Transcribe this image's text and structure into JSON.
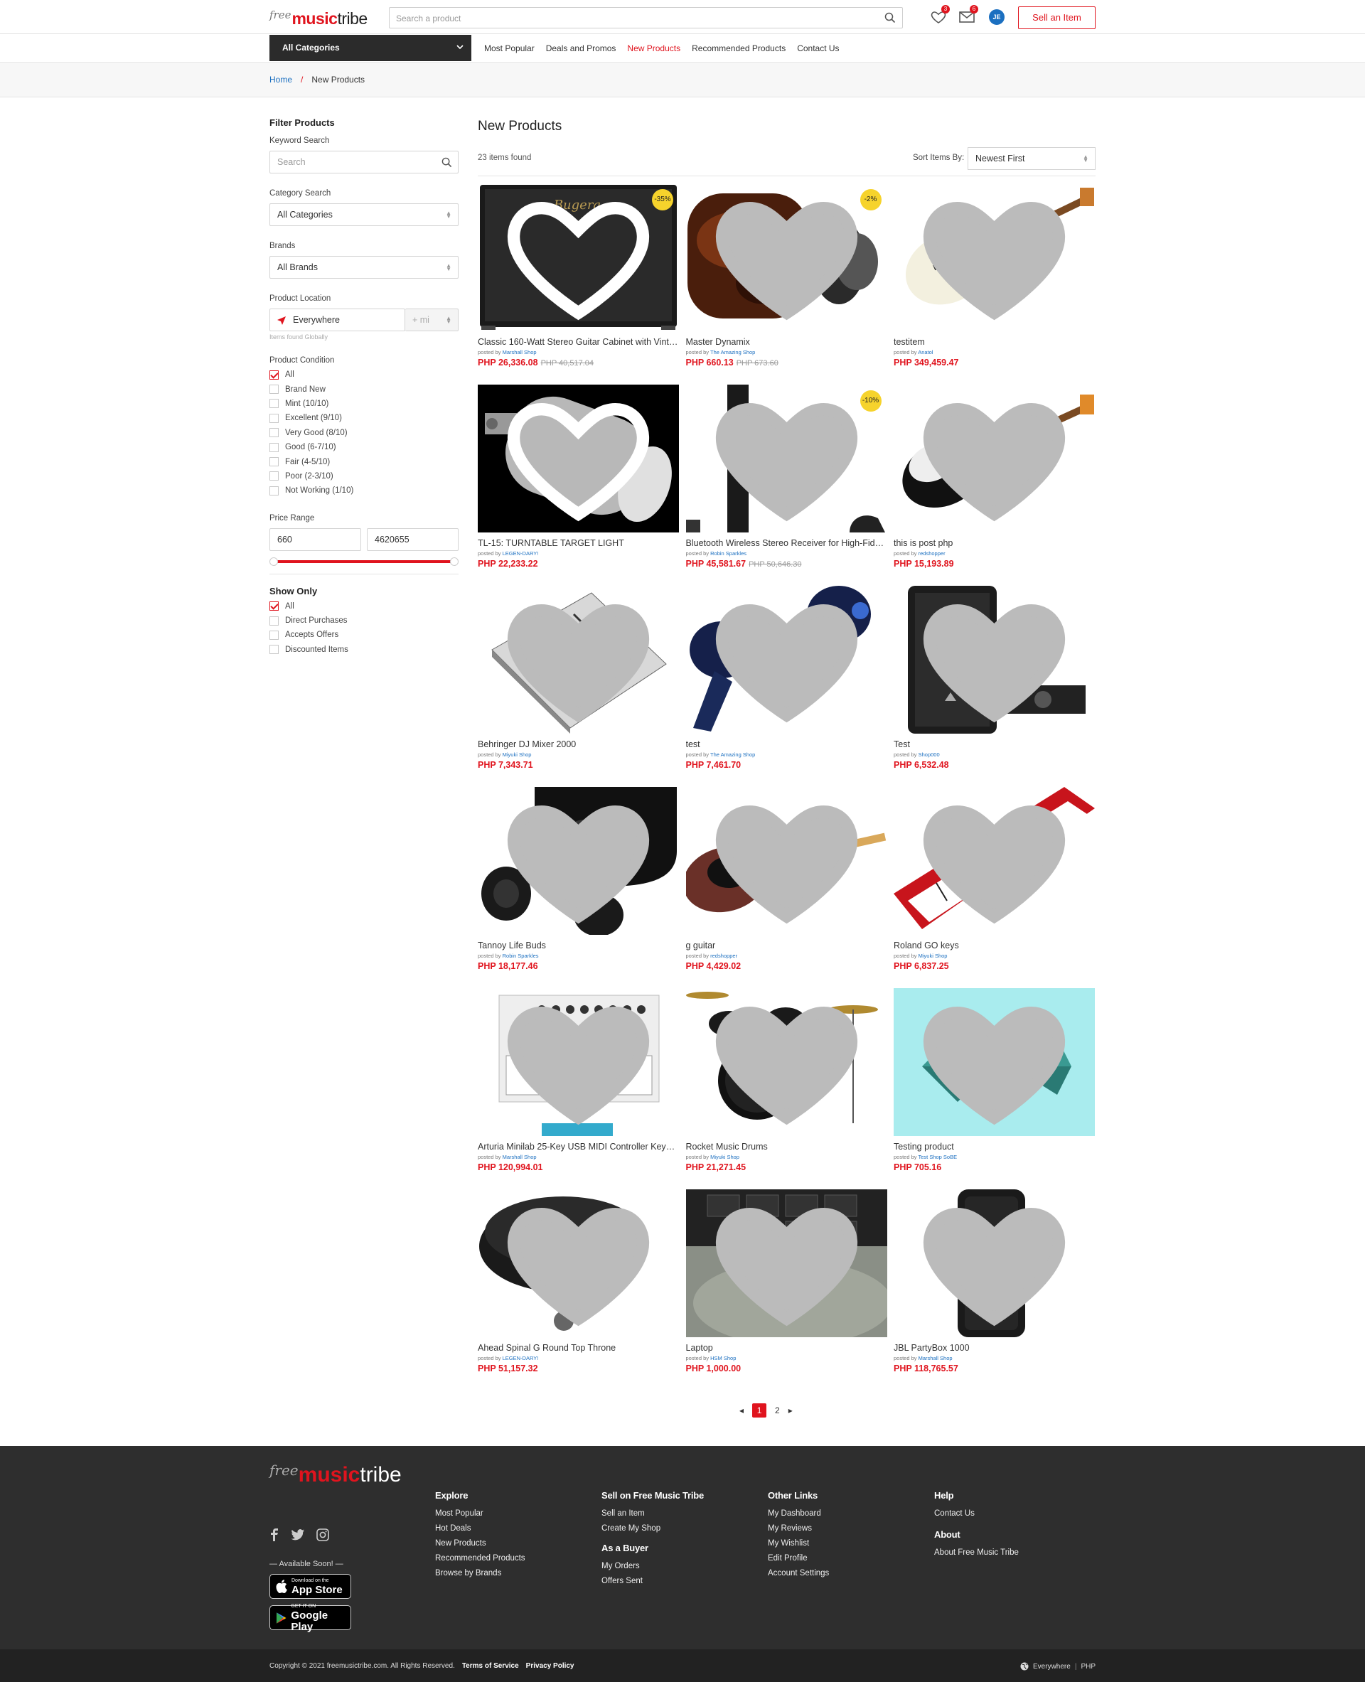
{
  "brand": {
    "free": "free",
    "music": "music",
    "tribe": "tribe"
  },
  "header": {
    "search_placeholder": "Search a product",
    "wishlist_count": "3",
    "messages_count": "6",
    "avatar_initials": "JE",
    "sell_button": "Sell an Item"
  },
  "nav": {
    "all_categories": "All Categories",
    "links": [
      "Most Popular",
      "Deals and Promos",
      "New Products",
      "Recommended Products",
      "Contact Us"
    ],
    "active": "New Products"
  },
  "breadcrumb": {
    "home": "Home",
    "sep": "/",
    "current": "New Products"
  },
  "filters": {
    "title": "Filter Products",
    "keyword_label": "Keyword Search",
    "keyword_placeholder": "Search",
    "category_label": "Category Search",
    "category_value": "All Categories",
    "brands_label": "Brands",
    "brands_value": "All Brands",
    "location_label": "Product Location",
    "location_value": "Everywhere",
    "location_unit": "+ mi",
    "location_note": "Items found Globally",
    "condition_label": "Product Condition",
    "conditions": [
      "All",
      "Brand New",
      "Mint (10/10)",
      "Excellent (9/10)",
      "Very Good (8/10)",
      "Good (6-7/10)",
      "Fair (4-5/10)",
      "Poor (2-3/10)",
      "Not Working (1/10)"
    ],
    "price_label": "Price Range",
    "price_min": "660",
    "price_max": "4620655",
    "show_label": "Show Only",
    "show_options": [
      "All",
      "Direct Purchases",
      "Accepts Offers",
      "Discounted Items"
    ]
  },
  "listing": {
    "title": "New Products",
    "count": "23 items found",
    "sort_label": "Sort Items By:",
    "sort_value": "Newest First",
    "posted_by": "posted by"
  },
  "products": [
    {
      "name": "Classic 160-Watt Stereo Guitar Cabinet with Vintage 30 Speakers",
      "shop": "Marshall Shop",
      "price": "PHP 26,336.08",
      "old": "PHP 40,517.04",
      "discount": "-35%",
      "img": "cabinet"
    },
    {
      "name": "Master Dynamix",
      "shop": "The Amazing Shop",
      "price": "PHP 660.13",
      "old": "PHP 673.60",
      "discount": "-2%",
      "img": "earbud"
    },
    {
      "name": "testitem",
      "shop": "Anatol",
      "price": "PHP 349,459.47",
      "old": "",
      "discount": "",
      "img": "guitar_white"
    },
    {
      "name": "TL-15: TURNTABLE TARGET LIGHT",
      "shop": "LEGEN-DARY!",
      "price": "PHP 22,233.22",
      "old": "",
      "discount": "",
      "img": "light"
    },
    {
      "name": "Bluetooth Wireless Stereo Receiver for High-Fidelity Audio",
      "shop": "Robin Sparkles",
      "price": "PHP 45,581.67",
      "old": "PHP 50,646.30",
      "discount": "-10%",
      "img": "stand"
    },
    {
      "name": "this is post php",
      "shop": "redshopper",
      "price": "PHP 15,193.89",
      "old": "",
      "discount": "",
      "img": "guitar_black"
    },
    {
      "name": "Behringer DJ Mixer 2000",
      "shop": "Miyuki Shop",
      "price": "PHP 7,343.71",
      "old": "",
      "discount": "",
      "img": "mixer"
    },
    {
      "name": "test",
      "shop": "The Amazing Shop",
      "price": "PHP 7,461.70",
      "old": "",
      "discount": "",
      "img": "buds_blue"
    },
    {
      "name": "Test",
      "shop": "Shop000",
      "price": "PHP 6,532.48",
      "old": "",
      "discount": "",
      "img": "speaker"
    },
    {
      "name": "Tannoy Life Buds",
      "shop": "Robin Sparkles",
      "price": "PHP 18,177.46",
      "old": "",
      "discount": "",
      "img": "buds_case"
    },
    {
      "name": "g guitar",
      "shop": "redshopper",
      "price": "PHP 4,429.02",
      "old": "",
      "discount": "",
      "img": "guitar_red"
    },
    {
      "name": "Roland GO keys",
      "shop": "Miyuki Shop",
      "price": "PHP 6,837.25",
      "old": "",
      "discount": "",
      "img": "keys"
    },
    {
      "name": "Arturia Minilab 25-Key USB MIDI Controller Keyboard",
      "shop": "Marshall Shop",
      "price": "PHP 120,994.01",
      "old": "",
      "discount": "",
      "img": "minilab"
    },
    {
      "name": "Rocket Music Drums",
      "shop": "Miyuki Shop",
      "price": "PHP 21,271.45",
      "old": "",
      "discount": "",
      "img": "drums"
    },
    {
      "name": "Testing product",
      "shop": "Test Shop SoBE",
      "price": "PHP 705.16",
      "old": "",
      "discount": "",
      "img": "landscape"
    },
    {
      "name": "Ahead Spinal G Round Top Throne",
      "shop": "LEGEN-DARY!",
      "price": "PHP 51,157.32",
      "old": "",
      "discount": "",
      "img": "throne"
    },
    {
      "name": "Laptop",
      "shop": "HSM Shop",
      "price": "PHP 1,000.00",
      "old": "",
      "discount": "",
      "img": "laptop"
    },
    {
      "name": "JBL PartyBox 1000",
      "shop": "Marshall Shop",
      "price": "PHP 118,765.57",
      "old": "",
      "discount": "",
      "img": "partybox"
    }
  ],
  "pagination": {
    "pages": [
      "1",
      "2"
    ],
    "current": "1"
  },
  "footer": {
    "explore": {
      "title": "Explore",
      "links": [
        "Most Popular",
        "Hot Deals",
        "New Products",
        "Recommended Products",
        "Browse by Brands"
      ]
    },
    "sell": {
      "title": "Sell on Free Music Tribe",
      "links": [
        "Sell an Item",
        "Create My Shop"
      ]
    },
    "buyer": {
      "title": "As a Buyer",
      "links": [
        "My Orders",
        "Offers Sent"
      ]
    },
    "other": {
      "title": "Other Links",
      "links": [
        "My Dashboard",
        "My Reviews",
        "My Wishlist",
        "Edit Profile",
        "Account Settings"
      ]
    },
    "help": {
      "title": "Help",
      "links": [
        "Contact Us"
      ]
    },
    "about": {
      "title": "About",
      "links": [
        "About Free Music Tribe"
      ]
    },
    "available": "— Available Soon! —",
    "appstore_small": "Download on the",
    "appstore_big": "App Store",
    "gplay_small": "GET IT ON",
    "gplay_big": "Google Play",
    "copyright": "Copyright © 2021 freemusictribe.com. All Rights Reserved.",
    "terms": "Terms of Service",
    "privacy": "Privacy Policy",
    "location": "Everywhere",
    "currency": "PHP",
    "sep": "|"
  },
  "colors": {
    "accent": "#e0141e",
    "link": "#1b6fc0",
    "footer_bg": "#2e2e2e",
    "nav_dark": "#2b2b2b",
    "badge_yellow": "#f6d32c"
  }
}
